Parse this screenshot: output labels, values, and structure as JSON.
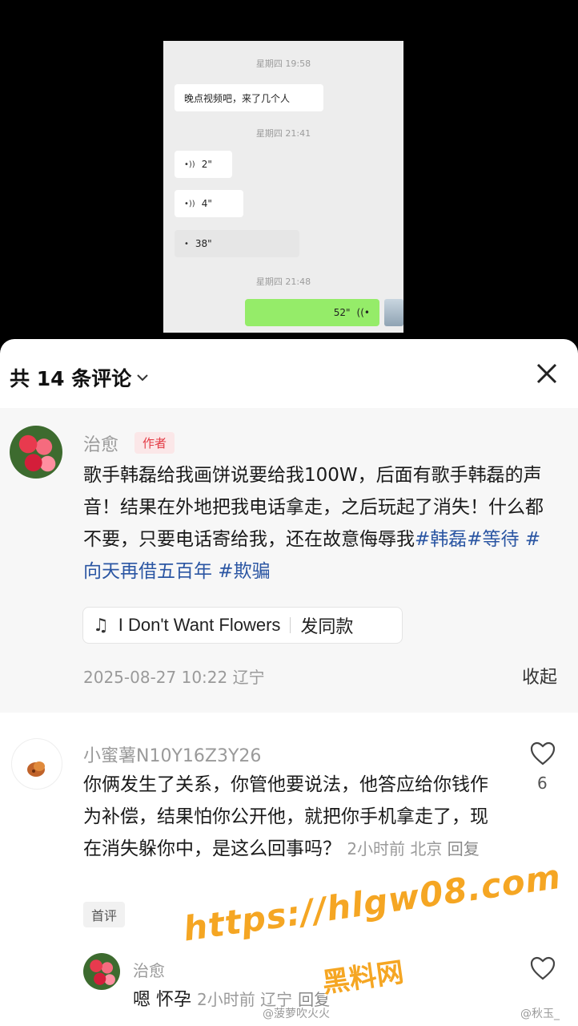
{
  "chat": {
    "time1": "星期四 19:58",
    "msg1": "晚点视频吧，来了几个人",
    "time2": "星期四 21:41",
    "voice1": "2\"",
    "voice2": "4\"",
    "voice3": "38\"",
    "time3": "星期四 21:48",
    "voice4": "52\""
  },
  "header": {
    "title": "共 14 条评论",
    "close_icon": "close-icon"
  },
  "author_comment": {
    "name": "治愈",
    "badge": "作者",
    "text_plain": "歌手韩磊给我画饼说要给我100W，后面有歌手韩磊的声音！结果在外地把我电话拿走，之后玩起了消失！什么都不要，只要电话寄给我，还在故意侮辱我",
    "tags": [
      "#韩磊",
      "#等待",
      " #向天再借五百年",
      " #欺骗"
    ],
    "music_title": "I Don't Want Flowers",
    "music_action": "发同款",
    "time_location": "2025-08-27 10:22 辽宁",
    "collapse": "收起"
  },
  "comment2": {
    "name": "小蜜薯N10Y16Z3Y26",
    "text": "你俩发生了关系，你管他要说法，他答应给你钱作为补偿，结果怕你公开他，就把你手机拿走了，现在消失躲你中，是这么回事吗？",
    "meta": "2小时前 北京",
    "reply": "回复",
    "likes": "6",
    "first_badge": "首评"
  },
  "reply1": {
    "name": "治愈",
    "text": "嗯 怀孕",
    "meta": "2小时前 辽宁",
    "reply": "回复"
  },
  "watermarks": {
    "url": "https://hlgw08.com",
    "site": "黑料网",
    "left": "@菠萝吹火火",
    "right": "@秋玉_"
  }
}
